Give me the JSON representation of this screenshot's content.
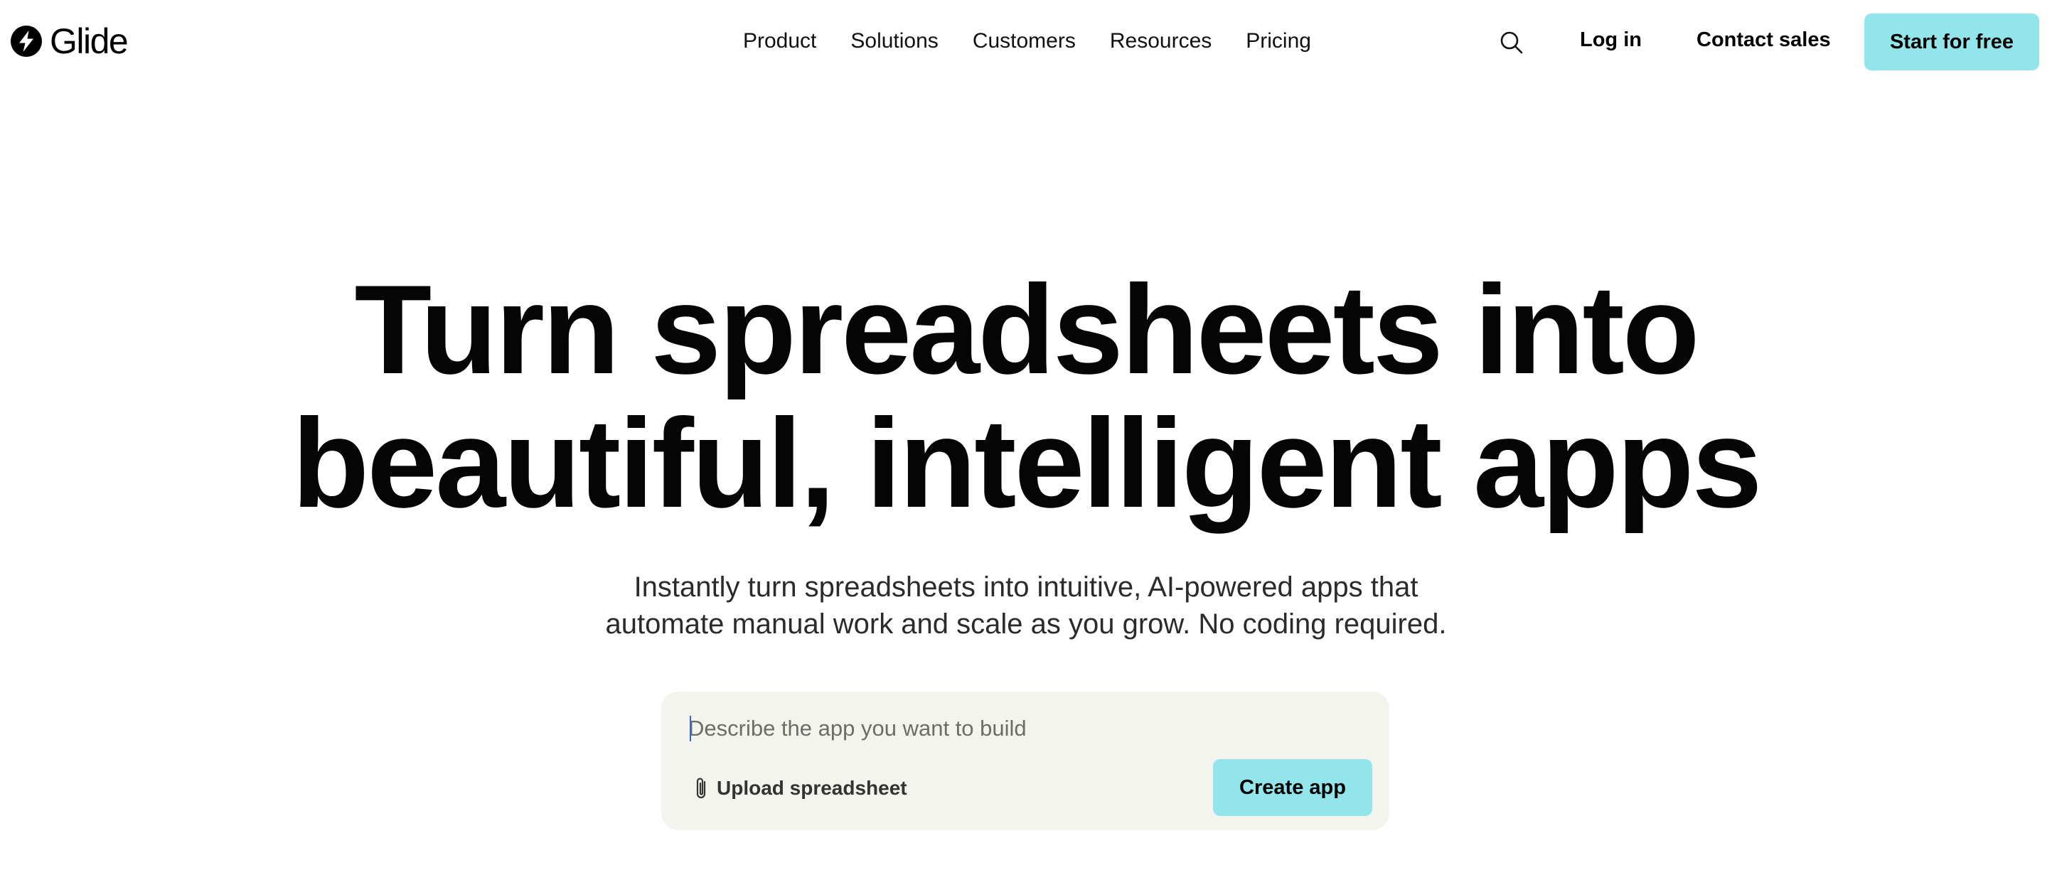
{
  "brand": {
    "name": "Glide",
    "logo_icon": "bolt-circle-icon"
  },
  "nav": {
    "items": [
      {
        "label": "Product"
      },
      {
        "label": "Solutions"
      },
      {
        "label": "Customers"
      },
      {
        "label": "Resources"
      },
      {
        "label": "Pricing"
      }
    ]
  },
  "header_actions": {
    "search_icon": "search-icon",
    "login_label": "Log in",
    "contact_label": "Contact sales",
    "start_label": "Start for free"
  },
  "hero": {
    "title_lines": [
      "Turn spreadsheets into",
      "beautiful, intelligent apps"
    ],
    "subtitle_lines": [
      "Instantly turn spreadsheets into intuitive, AI-powered apps that",
      "automate manual work and scale as you grow. No coding required."
    ]
  },
  "prompt": {
    "placeholder": "Describe the app you want to build",
    "value": "",
    "upload_icon": "paperclip-icon",
    "upload_label": "Upload spreadsheet",
    "create_label": "Create app"
  },
  "colors": {
    "accent": "#92e5ea",
    "prompt_background": "#f4f4ef",
    "text": "#0b0b0b"
  }
}
